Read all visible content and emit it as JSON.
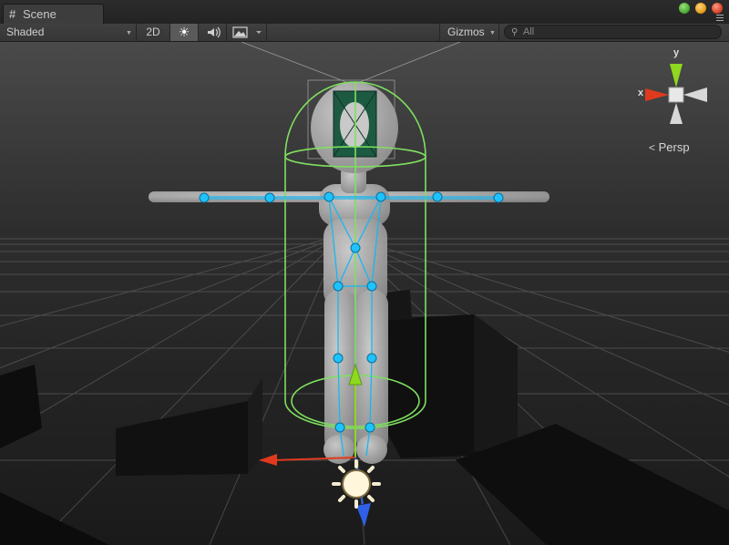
{
  "window": {
    "tab_label": "Scene",
    "tab_icon": "hash-grid-icon",
    "buttons": [
      {
        "name": "minimize",
        "color": "#4caf37"
      },
      {
        "name": "maximize",
        "color": "#e8a21e"
      },
      {
        "name": "close",
        "color": "#d9472b"
      }
    ]
  },
  "toolbar": {
    "shading_mode": "Shaded",
    "mode_2d": "2D",
    "lighting_toggle": "sun-icon",
    "audio_toggle": "speaker-icon",
    "effects_toggle": "image-icon",
    "gizmos_label": "Gizmos",
    "search_value": "All",
    "search_icon": "search-icon"
  },
  "viewport": {
    "projection_label": "Persp",
    "orientation_gizmo": {
      "x_label": "x",
      "y_label": "y",
      "x_color": "#e03a1e",
      "y_color": "#8ed81f",
      "z_color": "#2e60e8"
    },
    "bone_color": "#18b7f0",
    "collider_color": "#7ee060",
    "background_color": "#1e1e1e",
    "grid_color": "#666666"
  }
}
